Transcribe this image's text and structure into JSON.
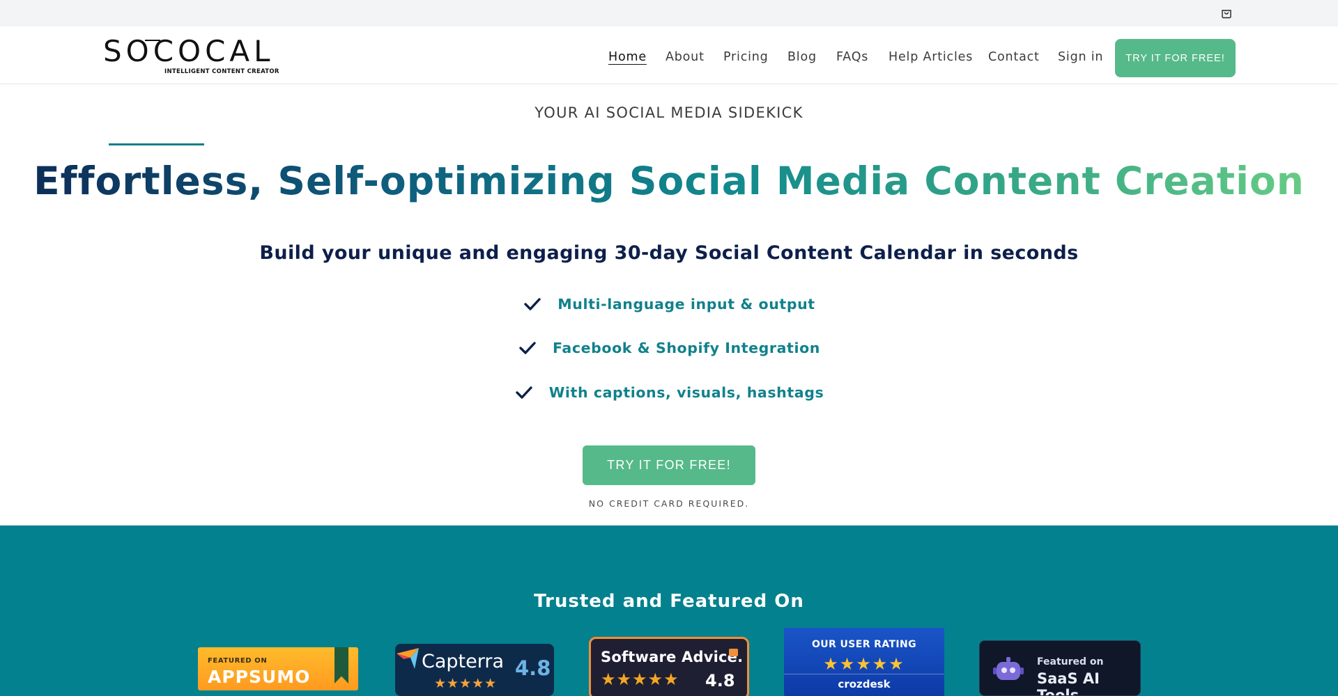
{
  "utility_bar": {
    "cart_icon": "cart-icon"
  },
  "header": {
    "logo": {
      "word": "SOCOCAL",
      "tagline": "INTELLIGENT CONTENT CREATOR"
    },
    "nav": [
      {
        "label": "Home",
        "active": true
      },
      {
        "label": "About",
        "active": false
      },
      {
        "label": "Pricing",
        "active": false
      },
      {
        "label": "Blog",
        "active": false
      },
      {
        "label": "FAQs",
        "active": false
      },
      {
        "label": "Help Articles",
        "active": false
      },
      {
        "label": "Contact",
        "active": false
      },
      {
        "label": "Sign in",
        "active": false
      }
    ],
    "cta_label": "TRY IT FOR FREE!"
  },
  "hero": {
    "eyebrow": "YOUR AI SOCIAL MEDIA SIDEKICK",
    "headline": "Effortless, Self-optimizing Social Media Content Creation",
    "subheadline": "Build your unique and engaging 30-day Social Content Calendar in seconds",
    "features": [
      "Multi-language input & output",
      "Facebook & Shopify Integration",
      "With captions, visuals, hashtags"
    ],
    "cta_label": "TRY IT FOR FREE!",
    "note": "NO CREDIT CARD REQUIRED."
  },
  "trusted": {
    "title": "Trusted and Featured On",
    "appsumo": {
      "small": "FEATURED ON",
      "big": "APPSUMO"
    },
    "capterra": {
      "name": "Capterra",
      "score": "4.8",
      "stars": "★★★★★"
    },
    "software_advice": {
      "name": "Software Advice.",
      "score": "4.8",
      "stars": "★★★★★"
    },
    "crozdesk": {
      "label": "OUR USER RATING",
      "stars": "★★★★★",
      "brand": "crozdesk"
    },
    "saas_ai_tools": {
      "small": "Featured on",
      "big": "SaaS AI Tools"
    }
  },
  "colors": {
    "accent_green": "#56b98a",
    "teal_band": "#03818f",
    "feature_text": "#11818c",
    "headline_dark": "#0d2a55"
  }
}
